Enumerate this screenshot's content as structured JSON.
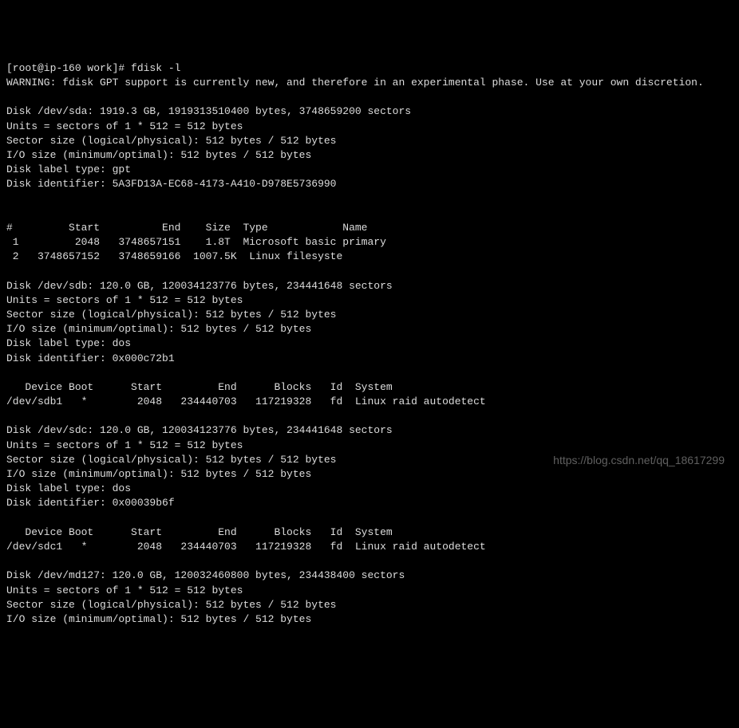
{
  "prompt": "[root@ip-160 work]# ",
  "command": "fdisk -l",
  "warning": "WARNING: fdisk GPT support is currently new, and therefore in an experimental phase. Use at your own discretion.",
  "disks": {
    "sda": {
      "header": "Disk /dev/sda: 1919.3 GB, 1919313510400 bytes, 3748659200 sectors",
      "units": "Units = sectors of 1 * 512 = 512 bytes",
      "sector": "Sector size (logical/physical): 512 bytes / 512 bytes",
      "io": "I/O size (minimum/optimal): 512 bytes / 512 bytes",
      "label": "Disk label type: gpt",
      "id": "Disk identifier: 5A3FD13A-EC68-4173-A410-D978E5736990",
      "table_header": "#         Start          End    Size  Type            Name",
      "row1": " 1         2048   3748657151    1.8T  Microsoft basic primary",
      "row2": " 2   3748657152   3748659166  1007.5K  Linux filesyste"
    },
    "sdb": {
      "header": "Disk /dev/sdb: 120.0 GB, 120034123776 bytes, 234441648 sectors",
      "units": "Units = sectors of 1 * 512 = 512 bytes",
      "sector": "Sector size (logical/physical): 512 bytes / 512 bytes",
      "io": "I/O size (minimum/optimal): 512 bytes / 512 bytes",
      "label": "Disk label type: dos",
      "id": "Disk identifier: 0x000c72b1",
      "table_header": "   Device Boot      Start         End      Blocks   Id  System",
      "row1": "/dev/sdb1   *        2048   234440703   117219328   fd  Linux raid autodetect"
    },
    "sdc": {
      "header": "Disk /dev/sdc: 120.0 GB, 120034123776 bytes, 234441648 sectors",
      "units": "Units = sectors of 1 * 512 = 512 bytes",
      "sector": "Sector size (logical/physical): 512 bytes / 512 bytes",
      "io": "I/O size (minimum/optimal): 512 bytes / 512 bytes",
      "label": "Disk label type: dos",
      "id": "Disk identifier: 0x00039b6f",
      "table_header": "   Device Boot      Start         End      Blocks   Id  System",
      "row1": "/dev/sdc1   *        2048   234440703   117219328   fd  Linux raid autodetect"
    },
    "md127": {
      "header": "Disk /dev/md127: 120.0 GB, 120032460800 bytes, 234438400 sectors",
      "units": "Units = sectors of 1 * 512 = 512 bytes",
      "sector": "Sector size (logical/physical): 512 bytes / 512 bytes",
      "io": "I/O size (minimum/optimal): 512 bytes / 512 bytes"
    }
  },
  "watermark": "https://blog.csdn.net/qq_18617299"
}
